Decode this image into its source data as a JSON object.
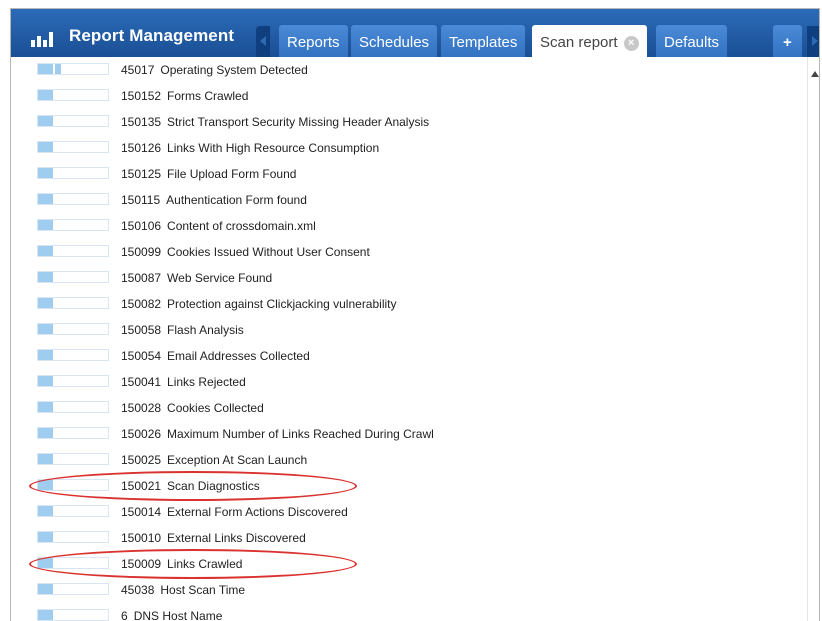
{
  "header": {
    "title": "Report Management",
    "logo_icon": "bar-chart-icon",
    "tabs": [
      {
        "label": "Reports",
        "active": false
      },
      {
        "label": "Schedules",
        "active": false
      },
      {
        "label": "Templates",
        "active": false
      },
      {
        "label": "Scan report",
        "active": true,
        "closable": true
      },
      {
        "label": "Defaults",
        "active": false
      }
    ],
    "add_tab_label": "+",
    "close_glyph": "×"
  },
  "colors": {
    "header": "#1f5aa2",
    "tab": "#3c7fd0",
    "severity_bar": "#9fcdf0",
    "highlight": "#d9322f"
  },
  "list": {
    "items": [
      {
        "qid": "45017",
        "name": "Operating System Detected",
        "severity": 2
      },
      {
        "qid": "150152",
        "name": "Forms Crawled",
        "severity": 1
      },
      {
        "qid": "150135",
        "name": "Strict Transport Security Missing Header Analysis",
        "severity": 1
      },
      {
        "qid": "150126",
        "name": "Links With High Resource Consumption",
        "severity": 1
      },
      {
        "qid": "150125",
        "name": "File Upload Form Found",
        "severity": 1
      },
      {
        "qid": "150115",
        "name": "Authentication Form found",
        "severity": 1
      },
      {
        "qid": "150106",
        "name": "Content of crossdomain.xml",
        "severity": 1
      },
      {
        "qid": "150099",
        "name": "Cookies Issued Without User Consent",
        "severity": 1
      },
      {
        "qid": "150087",
        "name": "Web Service Found",
        "severity": 1
      },
      {
        "qid": "150082",
        "name": "Protection against Clickjacking vulnerability",
        "severity": 1
      },
      {
        "qid": "150058",
        "name": "Flash Analysis",
        "severity": 1
      },
      {
        "qid": "150054",
        "name": "Email Addresses Collected",
        "severity": 1
      },
      {
        "qid": "150041",
        "name": "Links Rejected",
        "severity": 1
      },
      {
        "qid": "150028",
        "name": "Cookies Collected",
        "severity": 1
      },
      {
        "qid": "150026",
        "name": "Maximum Number of Links Reached During Crawl",
        "severity": 1
      },
      {
        "qid": "150025",
        "name": "Exception At Scan Launch",
        "severity": 1
      },
      {
        "qid": "150021",
        "name": "Scan Diagnostics",
        "severity": 1,
        "highlighted": true
      },
      {
        "qid": "150014",
        "name": "External Form Actions Discovered",
        "severity": 1
      },
      {
        "qid": "150010",
        "name": "External Links Discovered",
        "severity": 1
      },
      {
        "qid": "150009",
        "name": "Links Crawled",
        "severity": 1,
        "highlighted": true
      },
      {
        "qid": "45038",
        "name": "Host Scan Time",
        "severity": 1
      },
      {
        "qid": "6",
        "name": "DNS Host Name",
        "severity": 1
      }
    ]
  }
}
